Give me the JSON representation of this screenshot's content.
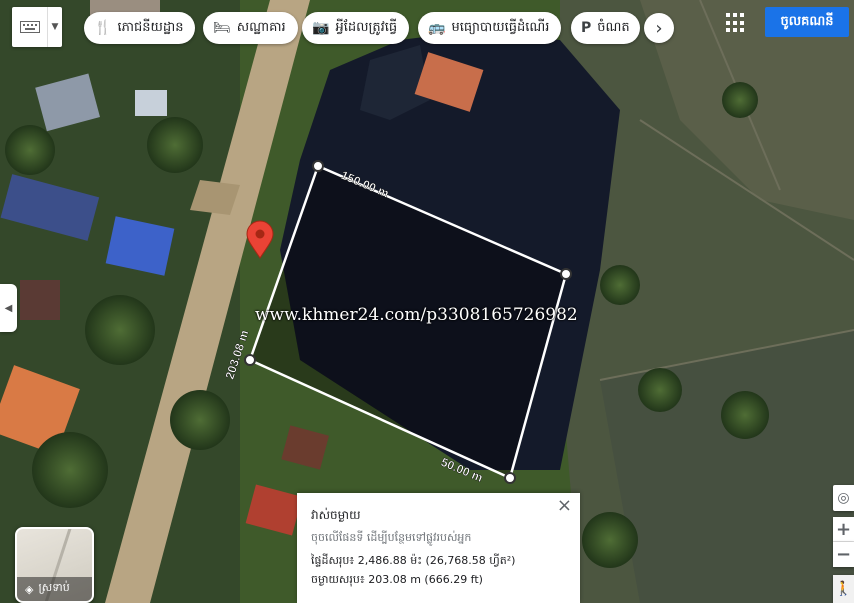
{
  "toolbar": {
    "chips": [
      {
        "label": "ភោជនីយដ្ឋាន",
        "icon": "restaurant-icon",
        "glyph": "🍴"
      },
      {
        "label": "សណ្ឋាគារ",
        "icon": "hotel-icon",
        "glyph": "🛏"
      },
      {
        "label": "អ្វីដែលត្រូវធ្វើ",
        "icon": "camera-icon",
        "glyph": "📷"
      },
      {
        "label": "មធ្យោបាយធ្វើដំណើរ",
        "icon": "bus-icon",
        "glyph": "🚌"
      },
      {
        "label": "ចំណត",
        "icon": "parking-icon",
        "glyph": "P"
      }
    ],
    "next_glyph": "›",
    "signin_label": "ចូលគណនី"
  },
  "map": {
    "watermark": "www.khmer24.com/p3308165726982",
    "measurements": {
      "top_edge": "150.00 m",
      "left_edge": "203.08 m",
      "bottom_edge": "50.00 m"
    },
    "colors": {
      "water": "#141a2a",
      "vegetation": "#3f5a2a",
      "road": "#b8a583",
      "measure_line": "#ffffff",
      "pin": "#ea4335"
    }
  },
  "panel": {
    "title": "វាស់ចម្ងាយ",
    "hint": "ចុចលើផែនទី ដើម្បីបន្ថែមទៅផ្លូវរបស់អ្នក",
    "area": "ផ្ទៃដីសរុប៖ 2,486.88 ម៉ះ (26,768.58 ហ្វីត²)",
    "distance": "ចម្ងាយសរុប៖ 203.08 m (666.29 ft)",
    "close_glyph": "×"
  },
  "layers": {
    "label": "ស្រទាប់"
  }
}
